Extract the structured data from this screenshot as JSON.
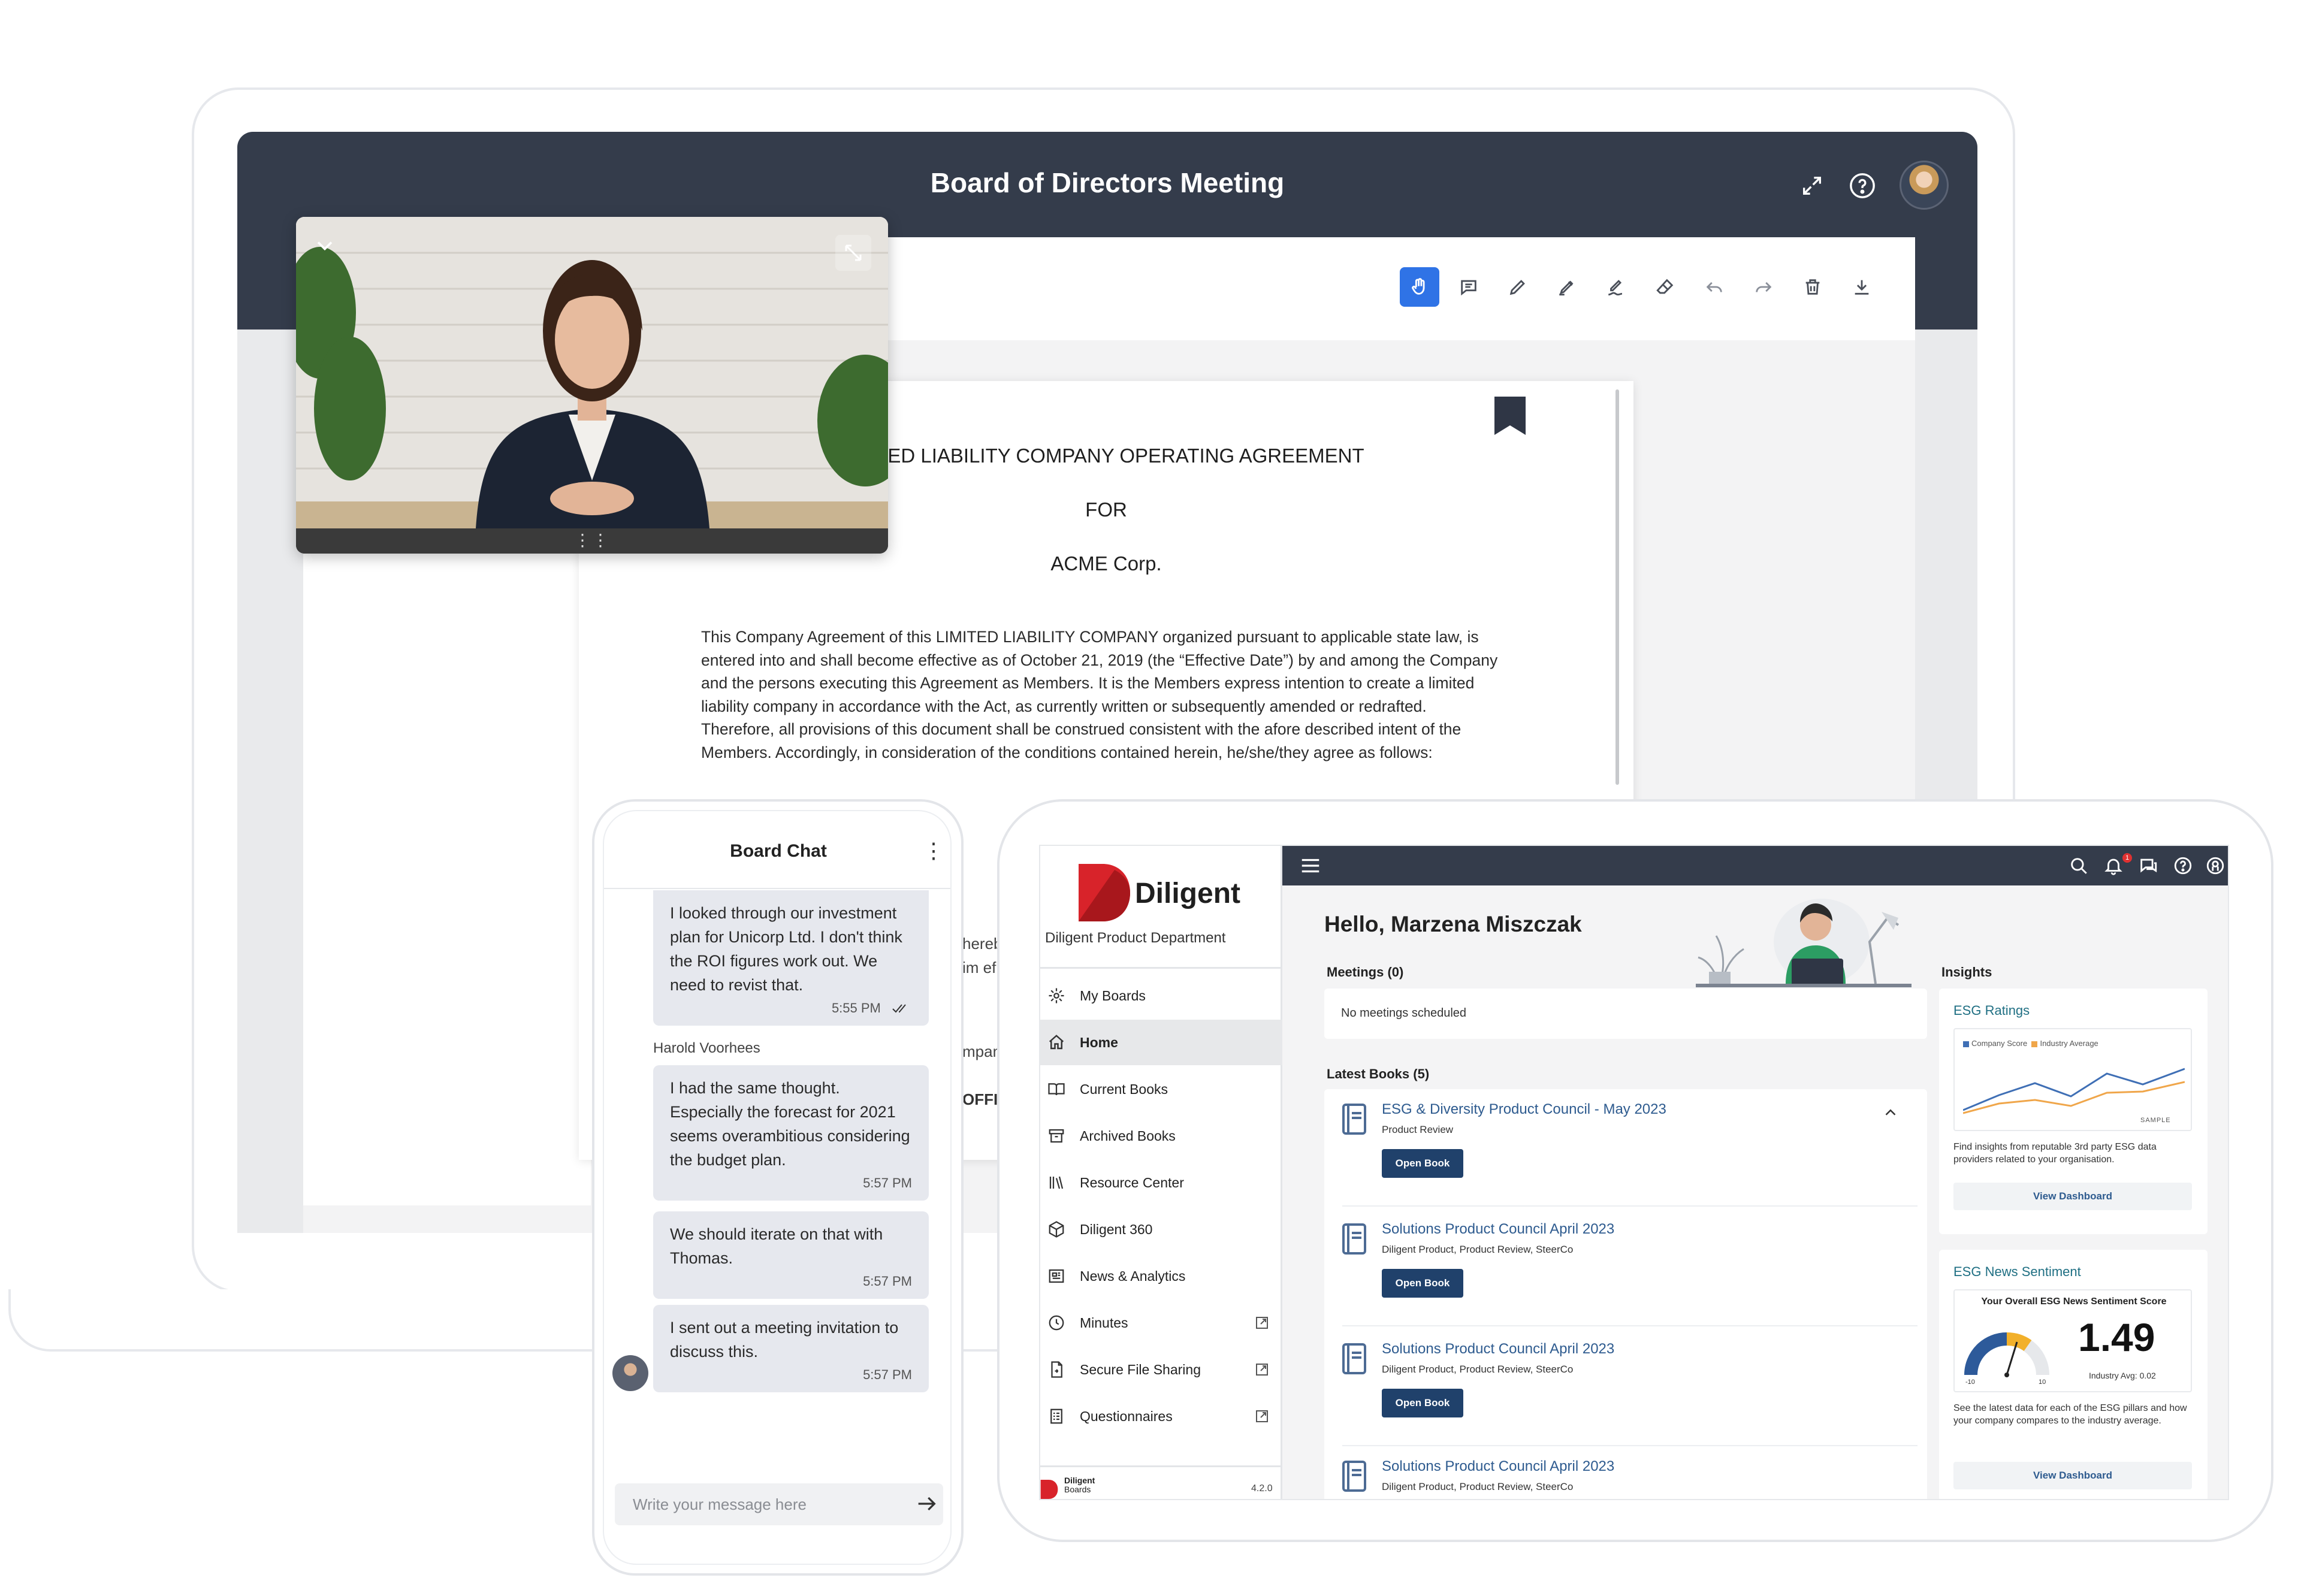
{
  "laptop": {
    "title": "Board of Directors Meeting",
    "header_icons": [
      "expand-icon",
      "help-icon",
      "user-avatar"
    ],
    "toolbar": [
      "hand-icon",
      "comment-icon",
      "pen-icon",
      "highlighter-icon",
      "signature-icon",
      "eraser-icon",
      "undo-icon",
      "redo-icon",
      "trash-icon",
      "download-icon"
    ],
    "document": {
      "heading_1": "IMITED LIABILITY COMPANY OPERATING AGREEMENT",
      "heading_2": "FOR",
      "heading_3": "ACME Corp.",
      "body": "This Company Agreement of this LIMITED LIABILITY COMPANY organized pursuant to applicable state law, is entered into and shall become effective as of October 21, 2019 (the “Effective Date”) by and among the Company and the persons executing this Agreement as Members. It is the Members express intention to create a limited liability company in accordance with the Act, as currently written or subsequently amended or redrafted. Therefore, all provisions of this document shall be construed consistent with the afore described intent of the Members. Accordingly, in consideration of the conditions contained herein, he/she/they agree as follows:",
      "fragments": [
        "hereb",
        "im ef",
        "mpan",
        "OFFIC"
      ]
    },
    "video": {
      "handle": "⋮⋮"
    }
  },
  "chat": {
    "title": "Board Chat",
    "messages": [
      {
        "text": "I looked through our investment plan for Unicorp Ltd. I don't think the ROI figures work out. We need to revist that.",
        "time": "5:55 PM"
      },
      {
        "sender": "Harold Voorhees",
        "text": "I had the same thought. Especially the forecast for 2021 seems overambitious considering the budget plan.",
        "time": "5:57 PM"
      },
      {
        "text": "We should iterate on that with Thomas.",
        "time": "5:57 PM"
      },
      {
        "text": "I sent out a meeting invitation to discuss this.",
        "time": "5:57 PM"
      }
    ],
    "input_placeholder": "Write your message here"
  },
  "tablet": {
    "brand": "Diligent",
    "department": "Diligent Product Department",
    "nav": [
      {
        "label": "My Boards",
        "icon": "boards-icon"
      },
      {
        "label": "Home",
        "icon": "home-icon",
        "active": true
      },
      {
        "label": "Current Books",
        "icon": "book-open-icon"
      },
      {
        "label": "Archived Books",
        "icon": "archive-icon"
      },
      {
        "label": "Resource Center",
        "icon": "library-icon"
      },
      {
        "label": "Diligent 360",
        "icon": "cube-icon"
      },
      {
        "label": "News & Analytics",
        "icon": "news-icon"
      },
      {
        "label": "Minutes",
        "icon": "clock-icon",
        "external": true
      },
      {
        "label": "Secure File Sharing",
        "icon": "file-share-icon",
        "external": true
      },
      {
        "label": "Questionnaires",
        "icon": "questionnaire-icon",
        "external": true
      }
    ],
    "footer": {
      "brand_line_1": "Diligent",
      "brand_line_2": "Boards",
      "version": "4.2.0"
    },
    "notification_count": "1",
    "greeting": "Hello, Marzena Miszczak",
    "meetings": {
      "title": "Meetings (0)",
      "empty": "No meetings scheduled"
    },
    "books": {
      "title": "Latest Books (5)",
      "button_label": "Open Book",
      "items": [
        {
          "title": "ESG & Diversity Product Council - May 2023",
          "subtitle": "Product Review"
        },
        {
          "title": "Solutions Product Council April 2023",
          "subtitle": "Diligent Product, Product Review, SteerCo"
        },
        {
          "title": "Solutions Product Council April 2023",
          "subtitle": "Diligent Product, Product Review, SteerCo"
        },
        {
          "title": "Solutions Product Council April 2023",
          "subtitle": "Diligent Product, Product Review, SteerCo"
        }
      ]
    },
    "insights": {
      "title": "Insights",
      "esg_ratings": {
        "title": "ESG Ratings",
        "legend": [
          "Company Score",
          "Industry Average"
        ],
        "sample": "SAMPLE",
        "description": "Find insights from reputable 3rd party ESG data providers related to your organisation.",
        "button": "View Dashboard",
        "colors": {
          "company": "#3f6fb5",
          "industry": "#f0a64a"
        }
      },
      "esg_news": {
        "title": "ESG News Sentiment",
        "box_title": "Your Overall ESG News Sentiment Score",
        "score": "1.49",
        "industry_avg": "Industry Avg: 0.02",
        "gauge_min": "-10",
        "gauge_max": "10",
        "description": "See the latest data for each of the ESG pillars and how your company compares to the industry average.",
        "button": "View Dashboard"
      }
    }
  }
}
